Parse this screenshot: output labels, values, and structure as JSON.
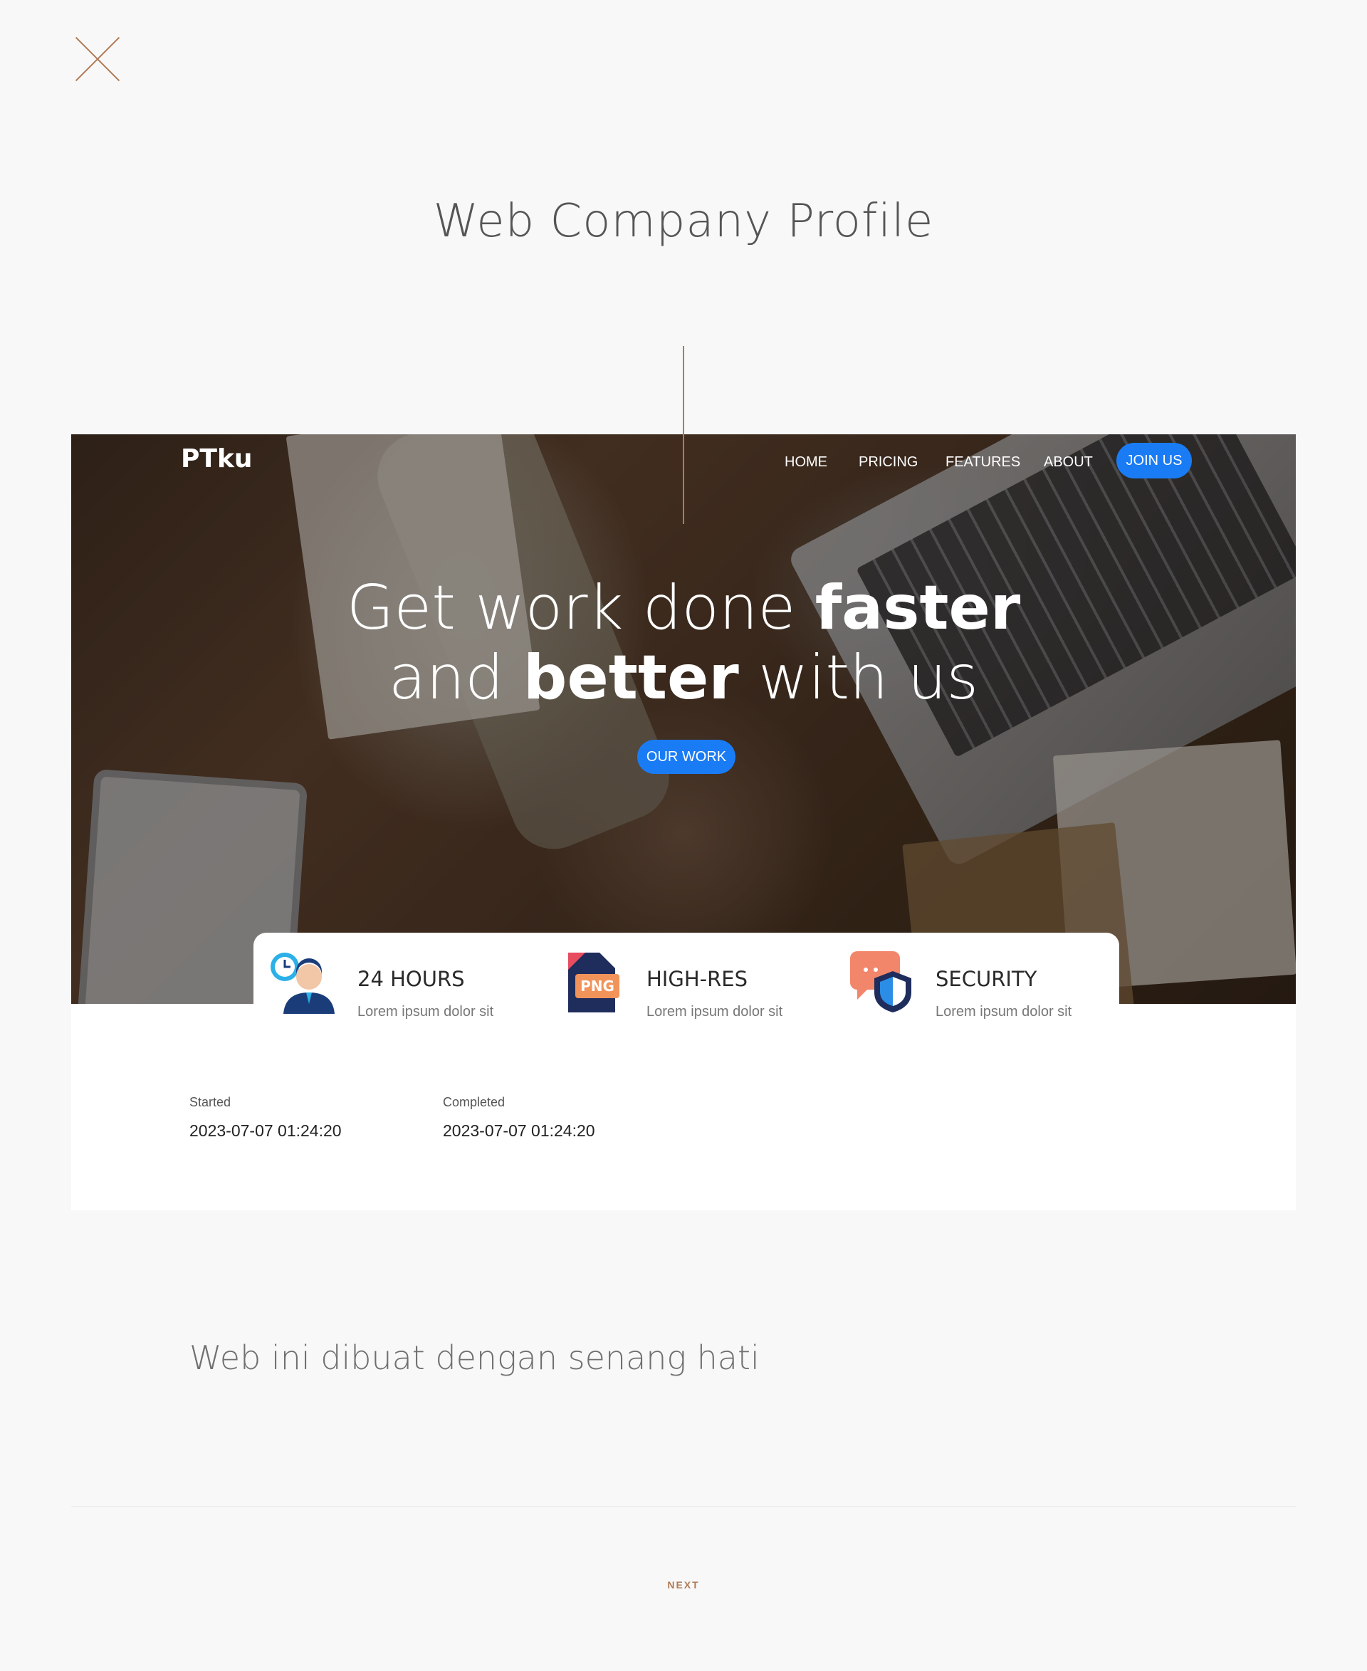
{
  "page": {
    "title": "Web Company Profile",
    "accent": "#b07a55"
  },
  "hero": {
    "logo": "PTku",
    "nav": [
      "HOME",
      "PRICING",
      "FEATURES",
      "ABOUT"
    ],
    "join_label": "JOIN US",
    "headline_1a": "Get work done ",
    "headline_1b": "faster",
    "headline_2a": "and ",
    "headline_2b": "better",
    "headline_2c": " with us",
    "cta_label": "OUR WORK",
    "button_color": "#1a7cf5"
  },
  "features": [
    {
      "title": "24 HOURS",
      "desc": "Lorem ipsum dolor sit",
      "icon": "support-agent-clock-icon"
    },
    {
      "title": "HIGH-RES",
      "desc": "Lorem ipsum dolor sit",
      "icon": "png-file-icon"
    },
    {
      "title": "SECURITY",
      "desc": "Lorem ipsum dolor sit",
      "icon": "chat-shield-icon"
    }
  ],
  "meta": {
    "started_label": "Started",
    "started_value": "2023-07-07 01:24:20",
    "completed_label": "Completed",
    "completed_value": "2023-07-07 01:24:20"
  },
  "footer": {
    "tagline": "Web ini dibuat dengan senang hati",
    "next_label": "NEXT"
  }
}
